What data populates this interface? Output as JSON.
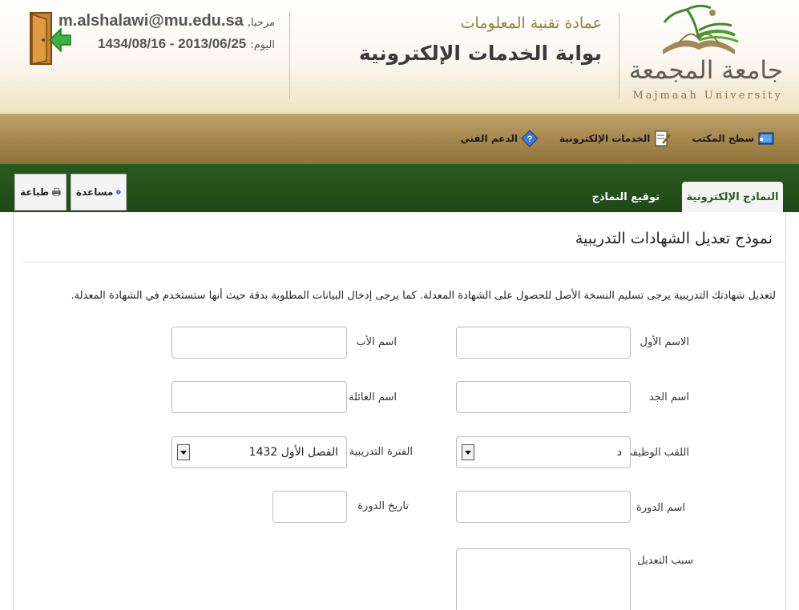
{
  "header": {
    "university_ar": "جامعة المجمعة",
    "university_en": "Majmaah University",
    "deanship": "عمادة تقنية المعلومات",
    "portal_title": "بوابة الخدمات الإلكترونية",
    "welcome_label": "مرحبا,",
    "user_email": "m.alshalawi@mu.edu.sa",
    "date_label": "اليوم:",
    "date_value": "2013/06/25 - 1434/08/16"
  },
  "nav": {
    "items": [
      {
        "label": "سطح المكتب",
        "icon": "desktop-icon"
      },
      {
        "label": "الخدمات الإلكترونية",
        "icon": "edit-form-icon"
      },
      {
        "label": "الدعم الفني",
        "icon": "question-diamond-icon"
      }
    ]
  },
  "tabs": {
    "active": "النماذج الإلكترونية",
    "inactive": "توقيع النماذج"
  },
  "tools": {
    "help": "مساعدة",
    "print": "طباعة"
  },
  "form": {
    "title": "نموذج تعديل الشهادات التدريبية",
    "instructions": "لتعديل شهادتك التدريبية يرجى تسليم النسخة الأصل للحصول على الشهادة المعدلة. كما يرجى إدخال البيانات المطلوبة بدقة حيث أنها ستستخدم في الشهادة المعدلة.",
    "first_name_label": "الاسم الأول",
    "father_name_label": "اسم الأب",
    "grandfather_name_label": "اسم الجد",
    "family_name_label": "اسم العائلة",
    "job_title_label": "اللقب الوظيفي",
    "job_title_value": "د",
    "training_period_label": "الفترة التدريبية",
    "training_period_value": "الفصل الأول 1432",
    "course_name_label": "اسم الدورة",
    "course_date_label": "تاريخ الدورة",
    "edit_reason_label": "سبب التعديل"
  },
  "colors": {
    "brand_gold": "#a7884e",
    "brand_green": "#2a5a1e",
    "logo_green": "#4a8a2e",
    "logout_arrow": "#3cb043"
  }
}
